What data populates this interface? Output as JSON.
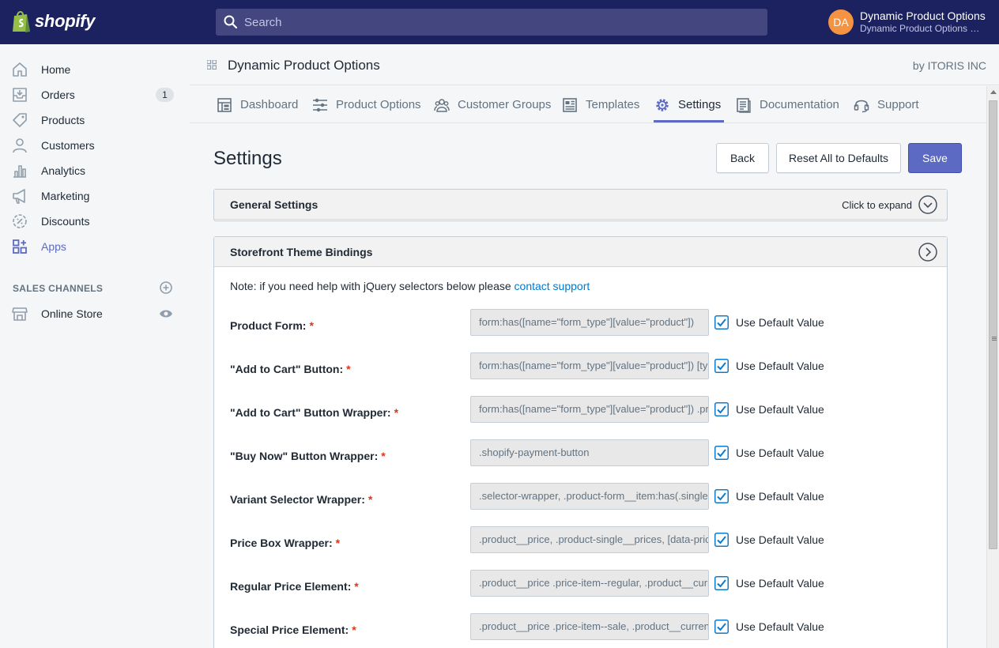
{
  "topbar": {
    "logo_text": "shopify",
    "search_placeholder": "Search",
    "account": {
      "initials": "DA",
      "name": "Dynamic Product Options",
      "shop": "Dynamic Product Options Demo"
    }
  },
  "sidebar": {
    "items": [
      {
        "label": "Home",
        "icon": "home-icon"
      },
      {
        "label": "Orders",
        "icon": "orders-icon",
        "badge": "1"
      },
      {
        "label": "Products",
        "icon": "tag-icon"
      },
      {
        "label": "Customers",
        "icon": "person-icon"
      },
      {
        "label": "Analytics",
        "icon": "bar-chart-icon"
      },
      {
        "label": "Marketing",
        "icon": "megaphone-icon"
      },
      {
        "label": "Discounts",
        "icon": "discount-icon"
      },
      {
        "label": "Apps",
        "icon": "apps-icon",
        "active": true
      }
    ],
    "channels_heading": "SALES CHANNELS",
    "channels": [
      {
        "label": "Online Store",
        "icon": "store-icon"
      }
    ]
  },
  "app_header": {
    "title": "Dynamic Product Options",
    "by": "by ITORIS INC"
  },
  "tabs": [
    {
      "label": "Dashboard",
      "icon": "dashboard-icon"
    },
    {
      "label": "Product Options",
      "icon": "sliders-icon"
    },
    {
      "label": "Customer Groups",
      "icon": "group-icon"
    },
    {
      "label": "Templates",
      "icon": "templates-icon"
    },
    {
      "label": "Settings",
      "icon": "gear-icon",
      "active": true
    },
    {
      "label": "Documentation",
      "icon": "document-icon"
    },
    {
      "label": "Support",
      "icon": "headset-icon"
    }
  ],
  "page": {
    "title": "Settings",
    "buttons": {
      "back": "Back",
      "reset": "Reset All to Defaults",
      "save": "Save"
    }
  },
  "general_panel": {
    "title": "General Settings",
    "expand_label": "Click to expand"
  },
  "bindings_panel": {
    "title": "Storefront Theme Bindings",
    "note_prefix": "Note: if you need help with jQuery selectors below please",
    "note_link": "contact support",
    "checkbox_label": "Use Default Value",
    "fields": [
      {
        "label": "Product Form:",
        "value": "form:has([name=\"form_type\"][value=\"product\"])",
        "checked": true
      },
      {
        "label": "\"Add to Cart\" Button:",
        "value": "form:has([name=\"form_type\"][value=\"product\"]) [type=\"submit\"]",
        "checked": true
      },
      {
        "label": "\"Add to Cart\" Button Wrapper:",
        "value": "form:has([name=\"form_type\"][value=\"product\"]) .product-form__controls-group",
        "checked": true
      },
      {
        "label": "\"Buy Now\" Button Wrapper:",
        "value": ".shopify-payment-button",
        "checked": true
      },
      {
        "label": "Variant Selector Wrapper:",
        "value": ".selector-wrapper, .product-form__item:has(.single-option-selector)",
        "checked": true
      },
      {
        "label": "Price Box Wrapper:",
        "value": ".product__price, .product-single__prices, [data-price-wrapper]",
        "checked": true
      },
      {
        "label": "Regular Price Element:",
        "value": ".product__price .price-item--regular, .product__current-price",
        "checked": true
      },
      {
        "label": "Special Price Element:",
        "value": ".product__price .price-item--sale, .product__current-price",
        "checked": true
      }
    ]
  },
  "colors": {
    "topbar": "#1c2260",
    "accent": "#5c6ac4",
    "link": "#007ace",
    "required": "#de3618",
    "checkbox": "#0f7bc8",
    "avatar": "#f49342"
  }
}
